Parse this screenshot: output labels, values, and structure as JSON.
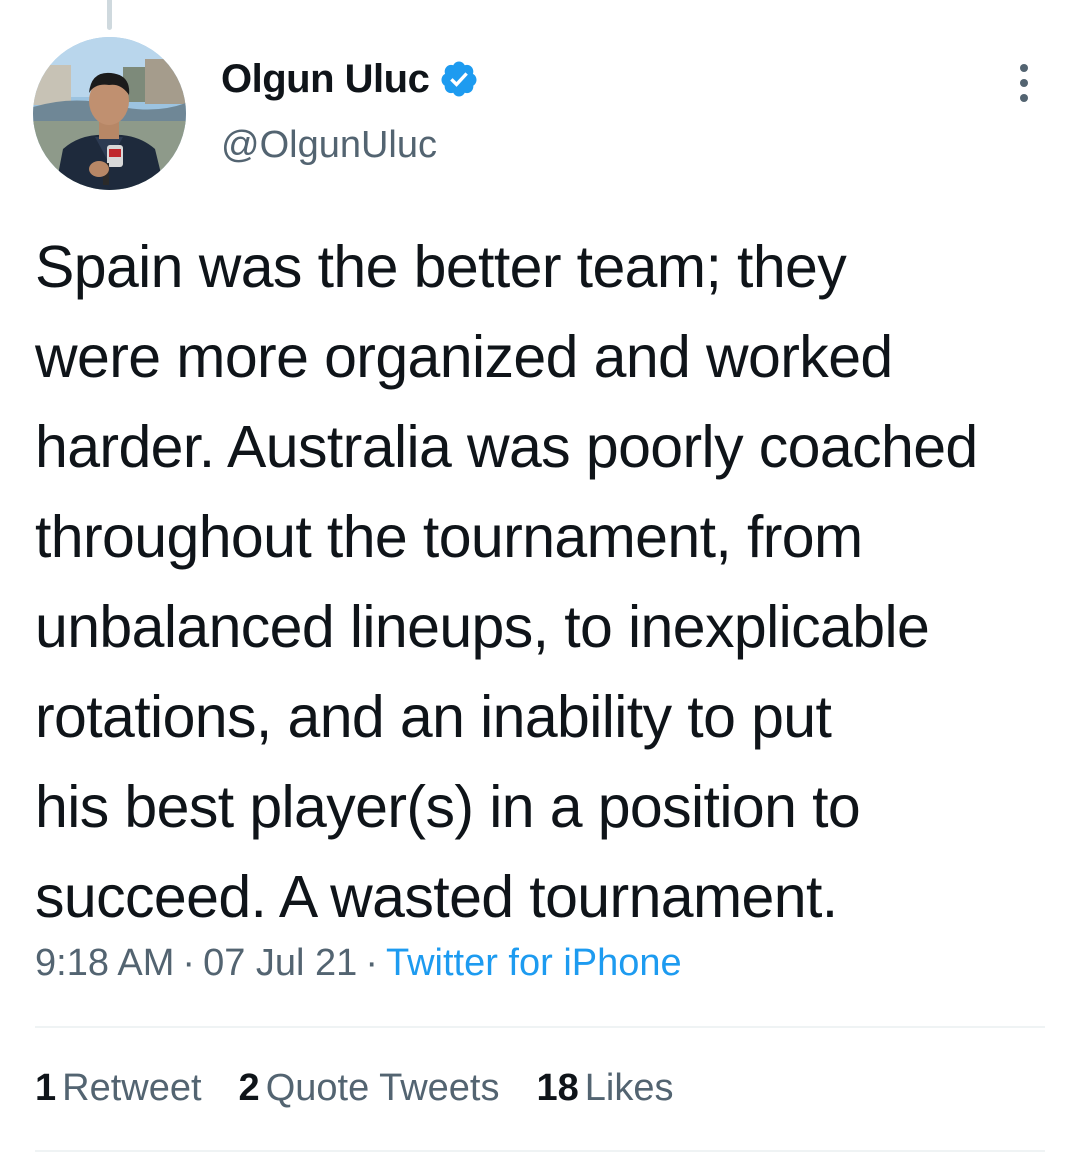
{
  "author": {
    "display_name": "Olgun Uluc",
    "handle": "@OlgunUluc",
    "verified_icon": "verified-badge-icon"
  },
  "menu": {
    "icon": "more-options-icon"
  },
  "tweet": {
    "lines": [
      "Spain was the better team; they",
      "were more organized and worked",
      "harder. Australia was poorly coached",
      "throughout the tournament, from",
      "unbalanced lineups, to inexplicable",
      "rotations, and an inability to put",
      "his best player(s) in a position to",
      "succeed. A wasted tournament."
    ]
  },
  "meta": {
    "time": "9:18 AM",
    "separator": "·",
    "date": "07 Jul 21",
    "source": "Twitter for iPhone"
  },
  "stats": {
    "retweets_count": "1",
    "retweets_label": "Retweet",
    "quotes_count": "2",
    "quotes_label": "Quote Tweets",
    "likes_count": "18",
    "likes_label": "Likes"
  },
  "colors": {
    "text_primary": "#0f1419",
    "text_secondary": "#536471",
    "link": "#1d9bf0",
    "divider": "#eff3f4"
  }
}
